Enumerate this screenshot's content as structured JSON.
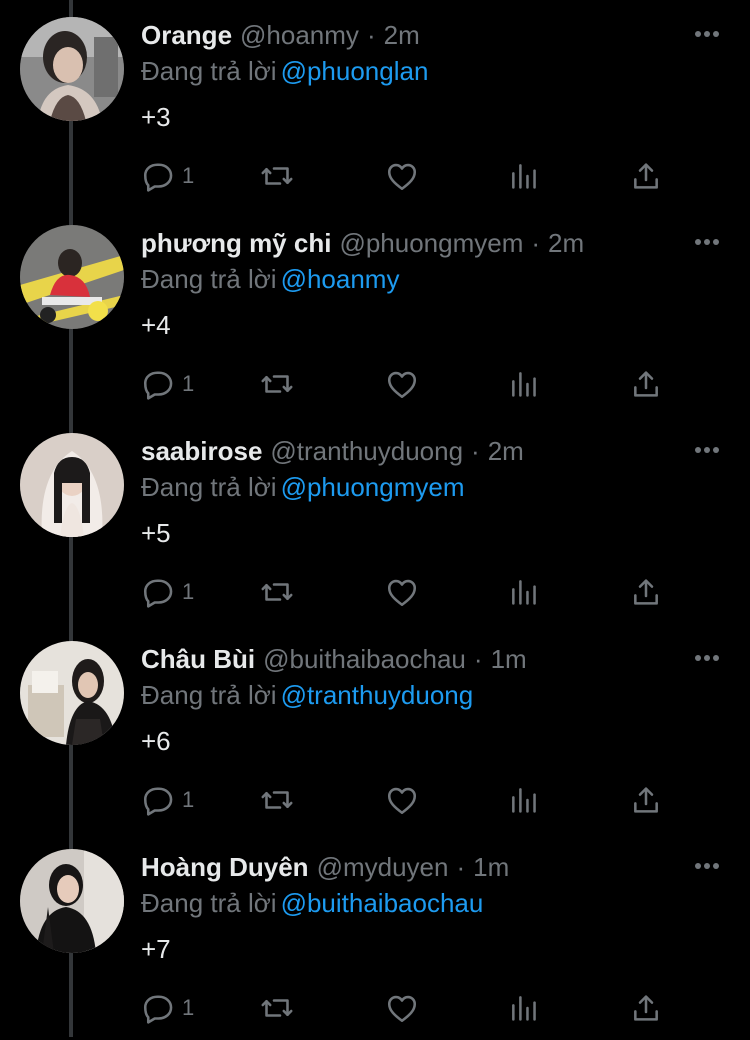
{
  "tweets": [
    {
      "name": "Orange",
      "handle": "@hoanmy",
      "time": "2m",
      "reply_prefix": "Đang trả lời",
      "reply_to": "@phuonglan",
      "text": "+3",
      "reply_count": "1"
    },
    {
      "name": "phương mỹ chi",
      "handle": "@phuongmyem",
      "time": "2m",
      "reply_prefix": "Đang trả lời",
      "reply_to": "@hoanmy",
      "text": "+4",
      "reply_count": "1"
    },
    {
      "name": "saabirose",
      "handle": "@tranthuyduong",
      "time": "2m",
      "reply_prefix": "Đang trả lời",
      "reply_to": "@phuongmyem",
      "text": "+5",
      "reply_count": "1"
    },
    {
      "name": "Châu Bùi",
      "handle": "@buithaibaochau",
      "time": "1m",
      "reply_prefix": "Đang trả lời",
      "reply_to": "@tranthuyduong",
      "text": "+6",
      "reply_count": "1"
    },
    {
      "name": "Hoàng Duyên",
      "handle": "@myduyen",
      "time": "1m",
      "reply_prefix": "Đang trả lời",
      "reply_to": "@buithaibaochau",
      "text": "+7",
      "reply_count": "1"
    }
  ],
  "separator": "·",
  "icons": {
    "reply": "reply-icon",
    "retweet": "retweet-icon",
    "like": "heart-icon",
    "views": "views-icon",
    "share": "share-icon",
    "more": "more-icon"
  },
  "colors": {
    "background": "#000000",
    "text_primary": "#e7e9ea",
    "text_secondary": "#71767b",
    "link": "#1d9bf0",
    "thread_line": "#333639"
  }
}
